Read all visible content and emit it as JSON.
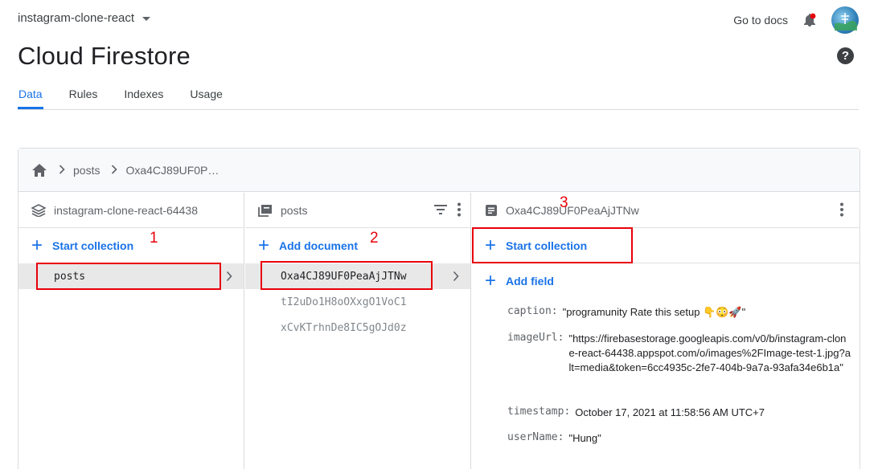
{
  "header": {
    "project_name": "instagram-clone-react",
    "docs_link": "Go to docs",
    "title": "Cloud Firestore",
    "help": "?"
  },
  "tabs": [
    {
      "label": "Data",
      "active": true
    },
    {
      "label": "Rules",
      "active": false
    },
    {
      "label": "Indexes",
      "active": false
    },
    {
      "label": "Usage",
      "active": false
    }
  ],
  "breadcrumb": {
    "items": [
      "posts",
      "Oxa4CJ89UF0P…"
    ]
  },
  "root_column": {
    "title": "instagram-clone-react-64438",
    "add_label": "Start collection",
    "items": [
      "posts"
    ]
  },
  "collection_column": {
    "title": "posts",
    "add_label": "Add document",
    "items": [
      "Oxa4CJ89UF0PeaAjJTNw",
      "tI2uDo1H8oOXxgO1VoC1",
      "xCvKTrhnDe8IC5gOJd0z"
    ]
  },
  "document_column": {
    "title": "Oxa4CJ89UF0PeaAjJTNw",
    "start_collection_label": "Start collection",
    "add_field_label": "Add field",
    "fields": [
      {
        "name": "caption:",
        "value": "\"programunity Rate this setup 👇😳🚀\""
      },
      {
        "name": "imageUrl:",
        "value": "\"https://firebasestorage.googleapis.com/v0/b/instagram-clone-react-64438.appspot.com/o/images%2FImage-test-1.jpg?alt=media&token=6cc4935c-2fe7-404b-9a7a-93afa34e6b1a\""
      },
      {
        "name": "timestamp:",
        "value": "October 17, 2021 at 11:58:56 AM UTC+7"
      },
      {
        "name": "userName:",
        "value": "\"Hung\""
      }
    ]
  },
  "annotations": [
    "1",
    "2",
    "3"
  ],
  "colors": {
    "accent": "#1a73e8",
    "annotation": "#e8000b"
  }
}
